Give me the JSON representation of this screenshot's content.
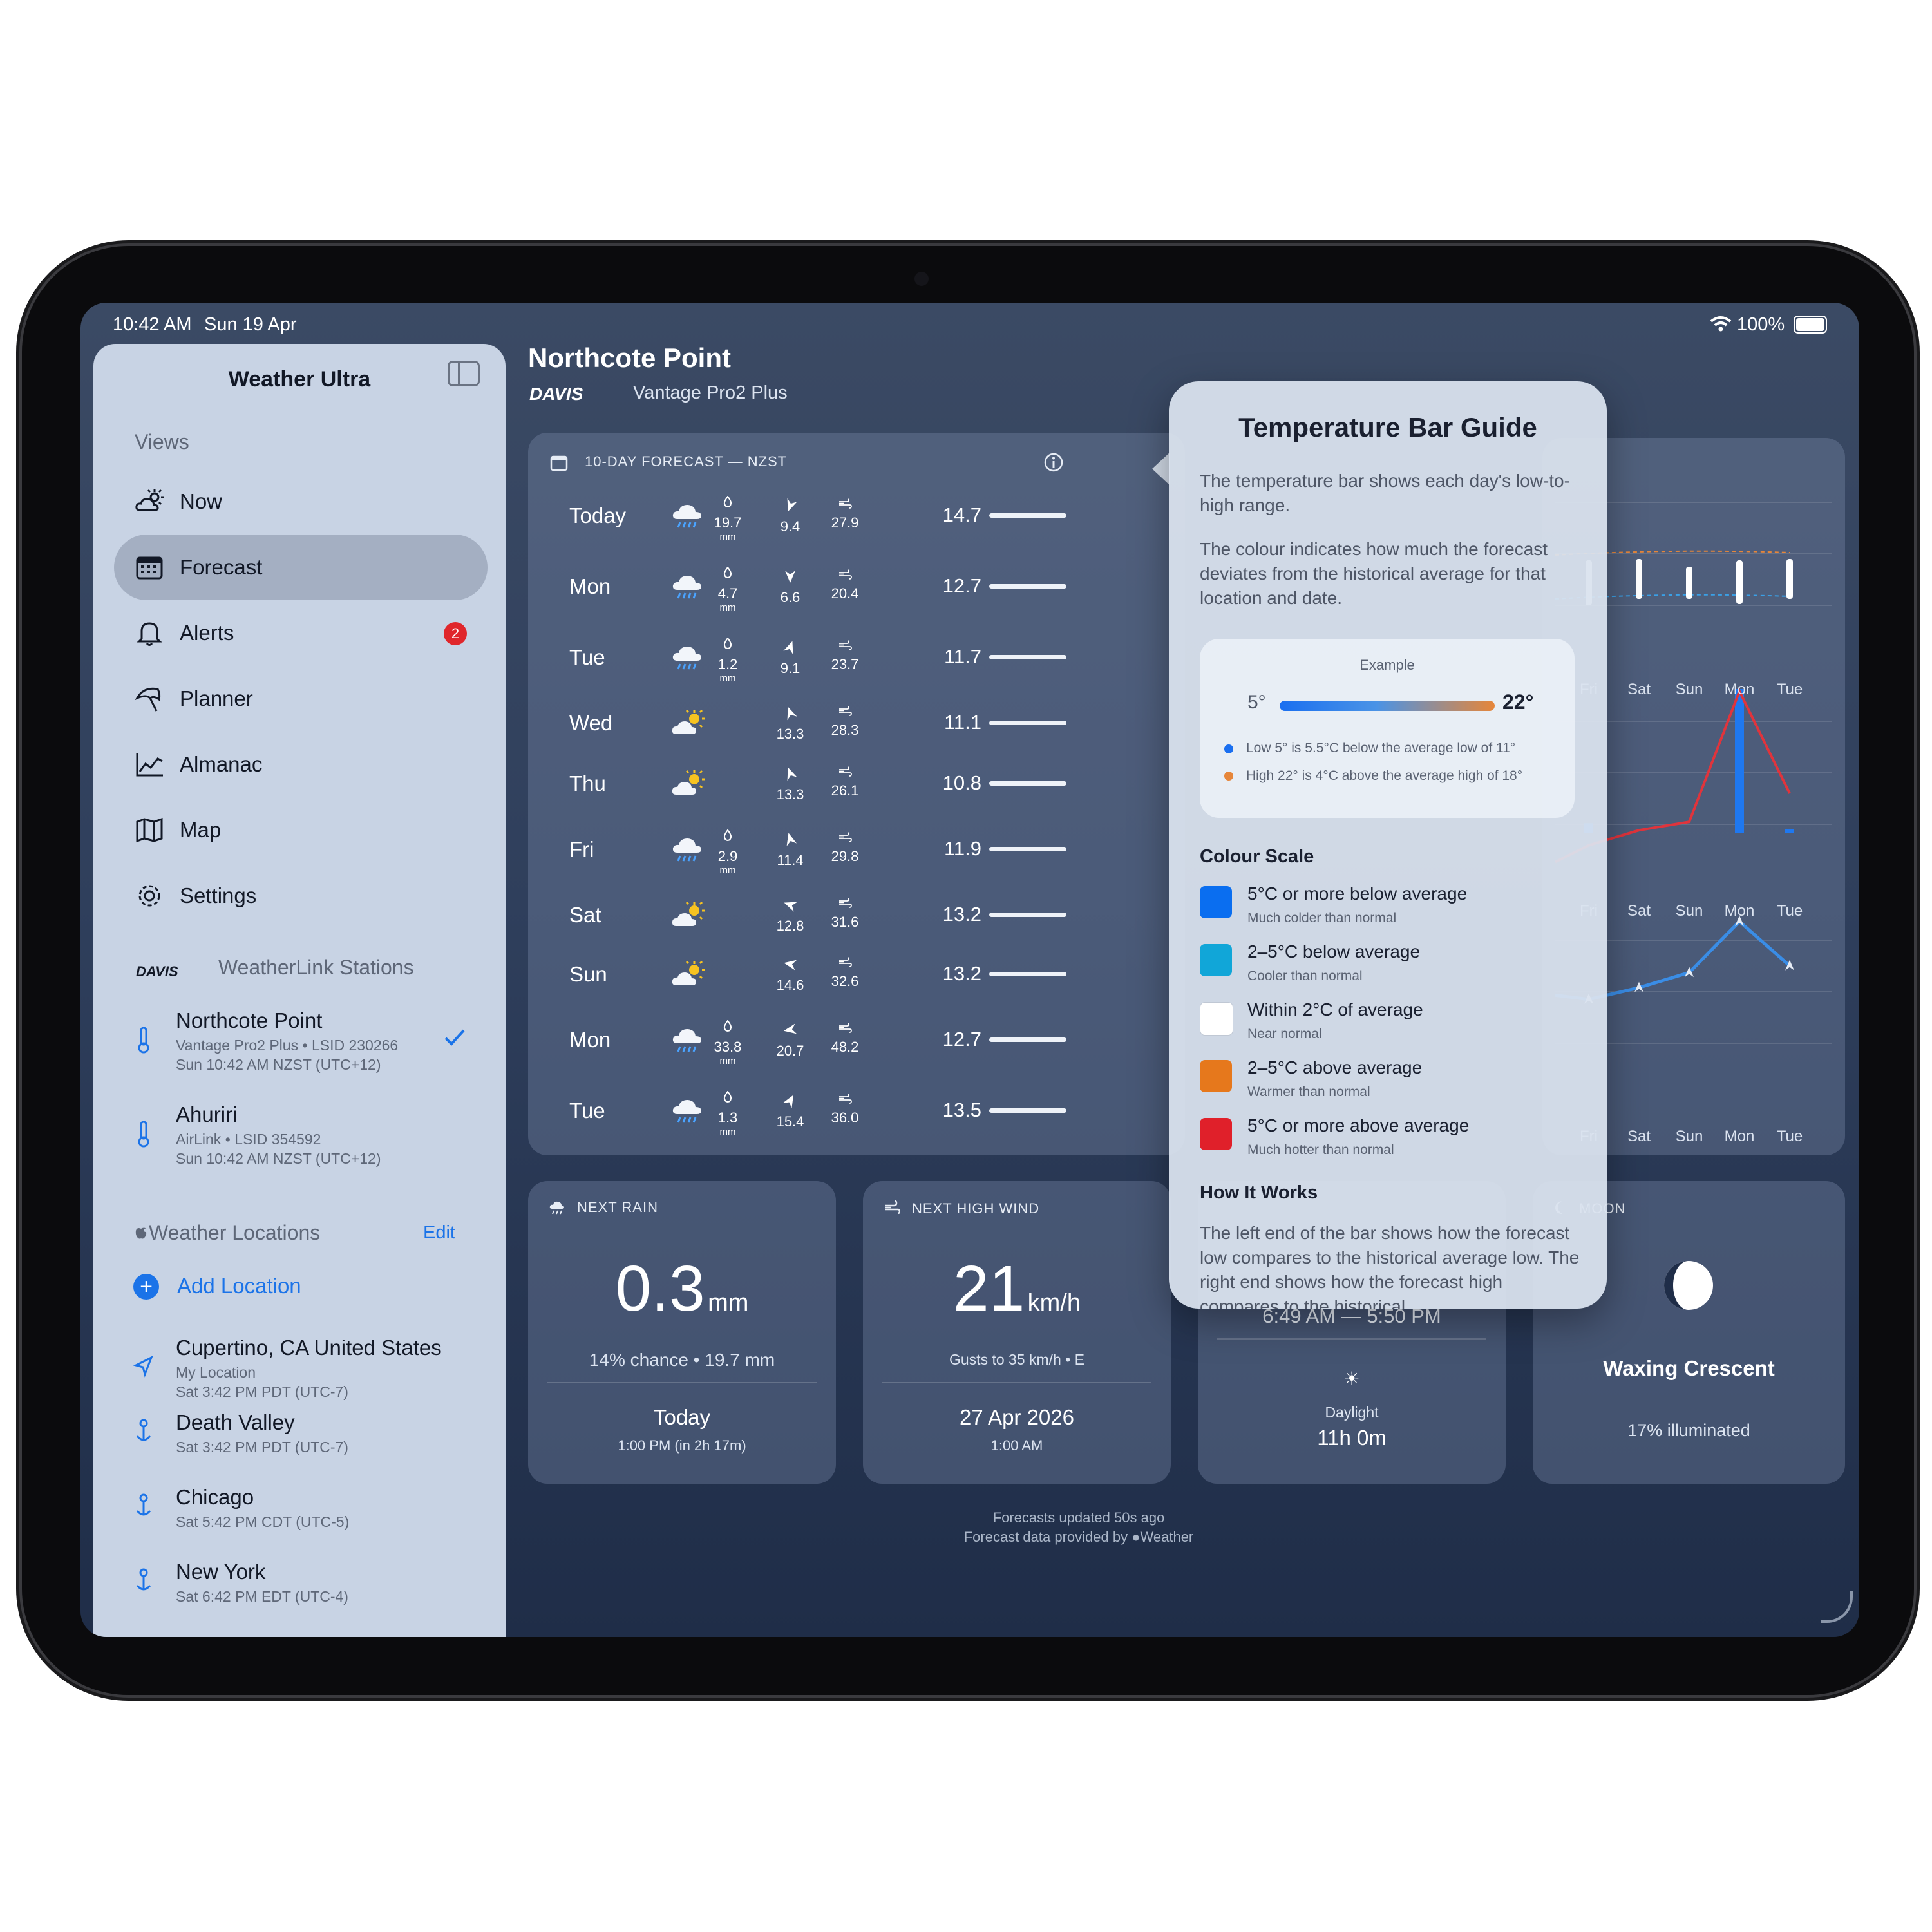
{
  "status_bar": {
    "time": "10:42 AM",
    "date": "Sun 19 Apr",
    "battery": "100%"
  },
  "sidebar": {
    "title": "Weather Ultra",
    "views_label": "Views",
    "nav": [
      {
        "label": "Now",
        "icon": "cloud-sun-icon"
      },
      {
        "label": "Forecast",
        "icon": "calendar-icon"
      },
      {
        "label": "Alerts",
        "icon": "bell-icon",
        "badge": "2"
      },
      {
        "label": "Planner",
        "icon": "umbrella-icon"
      },
      {
        "label": "Almanac",
        "icon": "line-chart-icon"
      },
      {
        "label": "Map",
        "icon": "map-icon"
      },
      {
        "label": "Settings",
        "icon": "gear-icon"
      }
    ],
    "stations_brand": "DAVIS",
    "stations_label": "WeatherLink Stations",
    "stations": [
      {
        "name": "Northcote Point",
        "model": "Vantage Pro2 Plus",
        "lsid": "LSID 230266",
        "time": "Sun 10:42 AM NZST (UTC+12)"
      },
      {
        "name": "Ahuriri",
        "model": "AirLink",
        "lsid": "LSID 354592",
        "time": "Sun 10:42 AM NZST (UTC+12)"
      }
    ],
    "locations_label": "Weather Locations",
    "edit_label": "Edit",
    "add_location_label": "Add Location",
    "locations": [
      {
        "name": "Cupertino, CA United States",
        "sub": "My Location",
        "time": "Sat 3:42 PM PDT (UTC-7)"
      },
      {
        "name": "Death Valley",
        "time": "Sat 3:42 PM PDT (UTC-7)"
      },
      {
        "name": "Chicago",
        "time": "Sat 5:42 PM CDT (UTC-5)"
      },
      {
        "name": "New York",
        "time": "Sat 6:42 PM EDT (UTC-4)"
      }
    ]
  },
  "header": {
    "location": "Northcote Point",
    "brand": "DAVIS",
    "station_model": "Vantage Pro2 Plus"
  },
  "forecast": {
    "title": "10-DAY FORECAST — NZST",
    "rain_unit": "mm",
    "days": [
      {
        "day": "Today",
        "icon": "rain-cloud-icon",
        "rain": "19.7",
        "wind": "9.4",
        "gust": "27.9",
        "low": "14.7"
      },
      {
        "day": "Mon",
        "icon": "rain-cloud-icon",
        "rain": "4.7",
        "wind": "6.6",
        "gust": "20.4",
        "low": "12.7"
      },
      {
        "day": "Tue",
        "icon": "rain-cloud-icon",
        "rain": "1.2",
        "wind": "9.1",
        "gust": "23.7",
        "low": "11.7"
      },
      {
        "day": "Wed",
        "icon": "partly-sunny-icon",
        "rain": "",
        "wind": "13.3",
        "gust": "28.3",
        "low": "11.1"
      },
      {
        "day": "Thu",
        "icon": "partly-sunny-icon",
        "rain": "",
        "wind": "13.3",
        "gust": "26.1",
        "low": "10.8"
      },
      {
        "day": "Fri",
        "icon": "rain-cloud-icon",
        "rain": "2.9",
        "wind": "11.4",
        "gust": "29.8",
        "low": "11.9"
      },
      {
        "day": "Sat",
        "icon": "partly-sunny-icon",
        "rain": "",
        "wind": "12.8",
        "gust": "31.6",
        "low": "13.2"
      },
      {
        "day": "Sun",
        "icon": "partly-sunny-icon",
        "rain": "",
        "wind": "14.6",
        "gust": "32.6",
        "low": "13.2"
      },
      {
        "day": "Mon",
        "icon": "rain-cloud-icon",
        "rain": "33.8",
        "wind": "20.7",
        "gust": "48.2",
        "low": "12.7"
      },
      {
        "day": "Tue",
        "icon": "rain-cloud-icon",
        "rain": "1.3",
        "wind": "15.4",
        "gust": "36.0",
        "low": "13.5"
      }
    ]
  },
  "chart_data": {
    "type": "bar",
    "visible_labels": [
      "Fri",
      "Sat",
      "Sun",
      "Mon",
      "Tue"
    ],
    "charts": [
      {
        "kind": "temperature-range",
        "categories": [
          "Fri",
          "Sat",
          "Sun",
          "Mon",
          "Tue"
        ]
      },
      {
        "kind": "rain",
        "categories": [
          "Fri",
          "Sat",
          "Sun",
          "Mon",
          "Tue"
        ],
        "relative_values": [
          0.07,
          0,
          0,
          1.0,
          0.03
        ]
      },
      {
        "kind": "wind",
        "categories": [
          "Fri",
          "Sat",
          "Sun",
          "Mon",
          "Tue"
        ],
        "series": [
          {
            "values": [
              11.4,
              12.8,
              14.6,
              20.7,
              15.4
            ]
          },
          {
            "values": [
              29.8,
              31.6,
              32.6,
              48.2,
              36.0
            ]
          }
        ]
      }
    ],
    "colors": {
      "rain": "#1f78f0",
      "wind": "#3a8de6",
      "gust": "#e0343c"
    }
  },
  "popover": {
    "title": "Temperature Bar Guide",
    "intro1": "The temperature bar shows each day's low-to-high range.",
    "intro2": "The colour indicates how much the forecast deviates from the historical average for that location and date.",
    "example_label": "Example",
    "example_low": "5°",
    "example_high": "22°",
    "example_note_low": "Low 5° is 5.5°C below the average low of 11°",
    "example_note_high": "High 22° is 4°C above the average high of 18°",
    "colour_scale_title": "Colour Scale",
    "scale": [
      {
        "label": "5°C or more below average",
        "sub": "Much colder than normal",
        "color": "#0a6ef0"
      },
      {
        "label": "2–5°C below average",
        "sub": "Cooler than normal",
        "color": "#11a6d8"
      },
      {
        "label": "Within 2°C of average",
        "sub": "Near normal",
        "color": "#ffffff"
      },
      {
        "label": "2–5°C above average",
        "sub": "Warmer than normal",
        "color": "#e6781c"
      },
      {
        "label": "5°C or more above average",
        "sub": "Much hotter than normal",
        "color": "#e0202a"
      }
    ],
    "how_title": "How It Works",
    "how_text": "The left end of the bar shows how the forecast low compares to the historical average low. The right end shows how the forecast high compares to the historical"
  },
  "tiles": {
    "rain": {
      "title": "NEXT RAIN",
      "value": "0.3",
      "unit": "mm",
      "detail": "14% chance • 19.7 mm",
      "when": "Today",
      "time": "1:00 PM (in 2h 17m)"
    },
    "wind": {
      "title": "NEXT HIGH WIND",
      "value": "21",
      "unit": "km/h",
      "detail": "Gusts to 35 km/h • E",
      "when": "27 Apr 2026",
      "time": "1:00 AM"
    },
    "sun": {
      "times": "6:49 AM — 5:50 PM",
      "daylight_label": "Daylight",
      "daylight": "11h 0m"
    },
    "moon": {
      "title": "MOON",
      "phase": "Waxing Crescent",
      "illum": "17% illuminated"
    }
  },
  "footer": {
    "updated": "Forecasts updated 50s ago",
    "provider_prefix": "Forecast data provided by",
    "provider": "Weather"
  }
}
